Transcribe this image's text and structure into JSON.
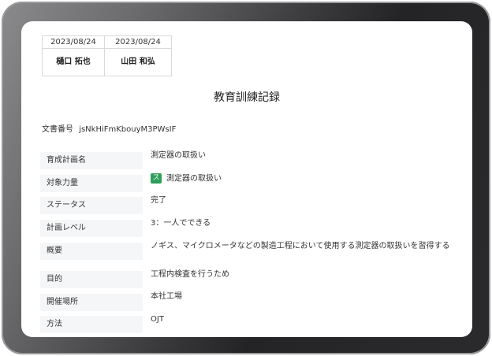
{
  "approvals": [
    {
      "date": "2023/08/24",
      "name": "樋口 拓也"
    },
    {
      "date": "2023/08/24",
      "name": "山田 和弘"
    }
  ],
  "title": "教育訓練記録",
  "document_number": {
    "label": "文書番号",
    "value": "jsNkHiFmKbouyM3PWsIF"
  },
  "fields": {
    "plan_name": {
      "label": "育成計画名",
      "value": "測定器の取扱い"
    },
    "target_skill": {
      "label": "対象力量",
      "badge": "ス",
      "value": "測定器の取扱い"
    },
    "status": {
      "label": "ステータス",
      "value": "完了"
    },
    "plan_level": {
      "label": "計画レベル",
      "value": "3：一人でできる"
    },
    "overview": {
      "label": "概要",
      "value": "ノギス、マイクロメータなどの製造工程において使用する測定器の取扱いを習得する"
    },
    "purpose": {
      "label": "目的",
      "value": "工程内検査を行うため"
    },
    "venue": {
      "label": "開催場所",
      "value": "本社工場"
    },
    "method": {
      "label": "方法",
      "value": "OJT"
    }
  },
  "colors": {
    "badge_green": "#2e9e5b",
    "label_bg": "#f5f6f7",
    "bezel": "#2b2b2d"
  }
}
